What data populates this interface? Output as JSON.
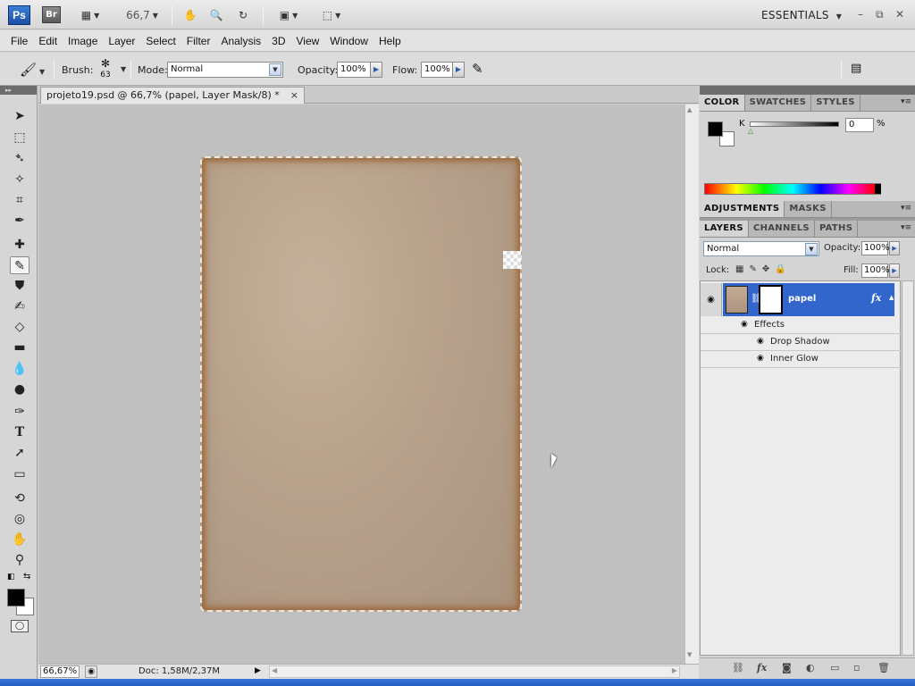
{
  "appbar": {
    "logo": "Ps",
    "bridge": "Br",
    "zoom": "66,7",
    "workspace": "ESSENTIALS",
    "win_minimize": "–",
    "win_restore": "⧉",
    "win_close": "✕"
  },
  "menu": [
    "File",
    "Edit",
    "Image",
    "Layer",
    "Select",
    "Filter",
    "Analysis",
    "3D",
    "View",
    "Window",
    "Help"
  ],
  "options": {
    "brush_label": "Brush:",
    "brush_size": "63",
    "mode_label": "Mode:",
    "mode_value": "Normal",
    "opacity_label": "Opacity:",
    "opacity_value": "100%",
    "flow_label": "Flow:",
    "flow_value": "100%"
  },
  "document": {
    "tab_title": "projeto19.psd @ 66,7% (papel, Layer Mask/8) *",
    "tab_close": "×",
    "zoom_status": "66,67%",
    "doc_info": "Doc: 1,58M/2,37M"
  },
  "color_panel": {
    "tabs": [
      "COLOR",
      "SWATCHES",
      "STYLES"
    ],
    "k_label": "K",
    "k_value": "0",
    "k_unit": "%",
    "foreground": "#000000",
    "background": "#ffffff"
  },
  "adjust_panel": {
    "tabs": [
      "ADJUSTMENTS",
      "MASKS"
    ]
  },
  "layers_panel": {
    "tabs": [
      "LAYERS",
      "CHANNELS",
      "PATHS"
    ],
    "blend_mode": "Normal",
    "opacity_label": "Opacity:",
    "opacity_value": "100%",
    "lock_label": "Lock:",
    "fill_label": "Fill:",
    "fill_value": "100%",
    "layer_name": "papel",
    "fx": "fx",
    "effects_label": "Effects",
    "effects": [
      "Drop Shadow",
      "Inner Glow"
    ]
  },
  "colors": {
    "accent": "#3366cc",
    "paper": "#b7a18b",
    "paper_edge": "#9c6b3e",
    "canvas_bg": "#c0c0c0"
  }
}
